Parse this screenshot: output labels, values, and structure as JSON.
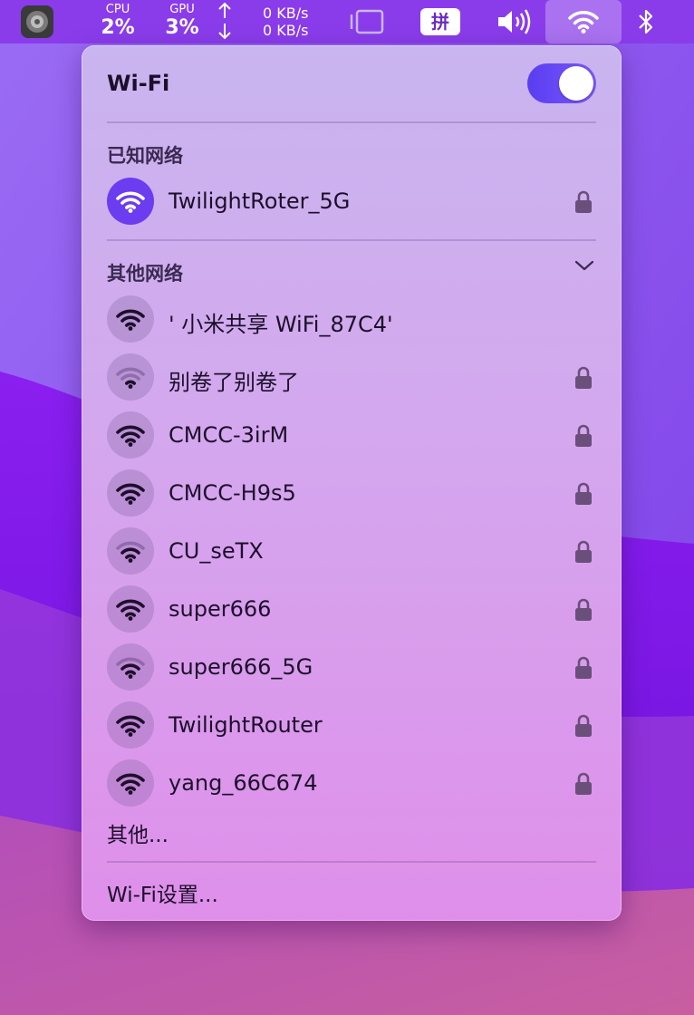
{
  "menubar": {
    "cpu": {
      "label": "CPU",
      "value": "2%"
    },
    "gpu": {
      "label": "GPU",
      "value": "3%"
    },
    "net": {
      "up": "0 KB/s",
      "down": "0 KB/s"
    },
    "input_method": "拼",
    "icons": [
      "system-stats-icon",
      "arrow-up-down-icon",
      "display-mirror-icon",
      "volume-icon",
      "wifi-icon",
      "bluetooth-icon"
    ]
  },
  "wifi_panel": {
    "title": "Wi-Fi",
    "enabled": true,
    "known_label": "已知网络",
    "known_networks": [
      {
        "name": "TwilightRoter_5G",
        "locked": true,
        "connected": true,
        "signal": 3
      }
    ],
    "other_label": "其他网络",
    "other_networks": [
      {
        "name": "'  小米共享 WiFi_87C4'",
        "locked": false,
        "signal": 3
      },
      {
        "name": "别卷了别卷了",
        "locked": true,
        "signal": 1
      },
      {
        "name": "CMCC-3irM",
        "locked": true,
        "signal": 3
      },
      {
        "name": "CMCC-H9s5",
        "locked": true,
        "signal": 3
      },
      {
        "name": "CU_seTX",
        "locked": true,
        "signal": 2
      },
      {
        "name": "super666",
        "locked": true,
        "signal": 3
      },
      {
        "name": "super666_5G",
        "locked": true,
        "signal": 2
      },
      {
        "name": "TwilightRouter",
        "locked": true,
        "signal": 3
      },
      {
        "name": "yang_66C674",
        "locked": true,
        "signal": 3
      }
    ],
    "other_item": "其他...",
    "settings_item": "Wi-Fi设置..."
  },
  "colors": {
    "accent": "#6b3cf0",
    "lock": "#6a4f7a"
  }
}
